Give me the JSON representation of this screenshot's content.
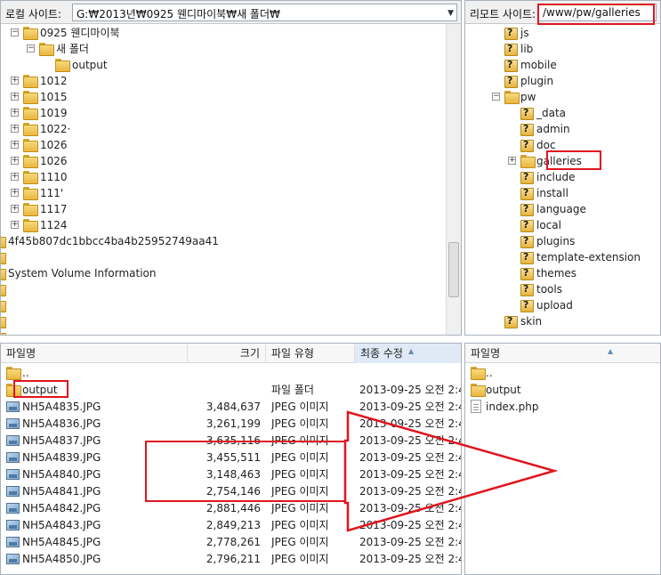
{
  "local_site": {
    "label": "로컬 사이트:",
    "path": "G:₩2013년₩0925 웬디마이북₩새 폴더₩",
    "tree": [
      {
        "label": "0925 웬디마이북",
        "level": 4,
        "state": "expanded",
        "type": "folder"
      },
      {
        "label": "새 폴더",
        "level": 5,
        "state": "expanded",
        "type": "folder"
      },
      {
        "label": "output",
        "level": 6,
        "state": "leaf",
        "type": "folder"
      },
      {
        "label": "1012",
        "level": 4,
        "state": "collapsed",
        "type": "folder"
      },
      {
        "label": "1015",
        "level": 4,
        "state": "collapsed",
        "type": "folder"
      },
      {
        "label": "1019",
        "level": 4,
        "state": "collapsed",
        "type": "folder"
      },
      {
        "label": "1022·",
        "level": 4,
        "state": "collapsed",
        "type": "folder"
      },
      {
        "label": "1026",
        "level": 4,
        "state": "collapsed",
        "type": "folder"
      },
      {
        "label": "1026",
        "level": 4,
        "state": "collapsed",
        "type": "folder"
      },
      {
        "label": "1110",
        "level": 4,
        "state": "collapsed",
        "type": "folder"
      },
      {
        "label": "111'",
        "level": 4,
        "state": "collapsed",
        "type": "folder"
      },
      {
        "label": "1117",
        "level": 4,
        "state": "collapsed",
        "type": "folder"
      },
      {
        "label": "1124",
        "level": 4,
        "state": "collapsed",
        "type": "folder"
      },
      {
        "label": "4f45b807dc1bbcc4ba4b25952749aa41",
        "level": 2,
        "state": "collapsed",
        "type": "folder"
      },
      {
        "label": "",
        "level": 2,
        "state": "leaf",
        "type": "folder"
      },
      {
        "label": "System Volume Information",
        "level": 2,
        "state": "leaf",
        "type": "folder"
      },
      {
        "label": "",
        "level": 2,
        "state": "collapsed",
        "type": "folder"
      },
      {
        "label": "",
        "level": 2,
        "state": "collapsed",
        "type": "folder"
      },
      {
        "label": "",
        "level": 2,
        "state": "collapsed",
        "type": "folder"
      },
      {
        "label": "",
        "level": 2,
        "state": "collapsed",
        "type": "folder"
      }
    ],
    "list_headers": [
      "파일명",
      "크기",
      "파일 유형",
      "최종 수정"
    ],
    "list": [
      {
        "name": "..",
        "size": "",
        "type": "",
        "modified": "",
        "icon": "folder"
      },
      {
        "name": "output",
        "size": "",
        "type": "파일 폴더",
        "modified": "2013-09-25 오전 2:4",
        "icon": "folder"
      },
      {
        "name": "NH5A4835.JPG",
        "size": "3,484,637",
        "type": "JPEG 이미지",
        "modified": "2013-09-25 오전 2:4",
        "icon": "image"
      },
      {
        "name": "NH5A4836.JPG",
        "size": "3,261,199",
        "type": "JPEG 이미지",
        "modified": "2013-09-25 오전 2:4",
        "icon": "image"
      },
      {
        "name": "NH5A4837.JPG",
        "size": "3,635,116",
        "type": "JPEG 이미지",
        "modified": "2013-09-25 오전 2:4",
        "icon": "image"
      },
      {
        "name": "NH5A4839.JPG",
        "size": "3,455,511",
        "type": "JPEG 이미지",
        "modified": "2013-09-25 오전 2:4",
        "icon": "image"
      },
      {
        "name": "NH5A4840.JPG",
        "size": "3,148,463",
        "type": "JPEG 이미지",
        "modified": "2013-09-25 오전 2:4",
        "icon": "image"
      },
      {
        "name": "NH5A4841.JPG",
        "size": "2,754,146",
        "type": "JPEG 이미지",
        "modified": "2013-09-25 오전 2:4",
        "icon": "image"
      },
      {
        "name": "NH5A4842.JPG",
        "size": "2,881,446",
        "type": "JPEG 이미지",
        "modified": "2013-09-25 오전 2:4",
        "icon": "image"
      },
      {
        "name": "NH5A4843.JPG",
        "size": "2,849,213",
        "type": "JPEG 이미지",
        "modified": "2013-09-25 오전 2:4",
        "icon": "image"
      },
      {
        "name": "NH5A4845.JPG",
        "size": "2,778,261",
        "type": "JPEG 이미지",
        "modified": "2013-09-25 오전 2:4",
        "icon": "image"
      },
      {
        "name": "NH5A4850.JPG",
        "size": "2,796,211",
        "type": "JPEG 이미지",
        "modified": "2013-09-25 오전 2:4",
        "icon": "image"
      }
    ]
  },
  "remote_site": {
    "label": "리모트 사이트:",
    "path": "/www/pw/galleries",
    "tree": [
      {
        "label": "js",
        "level": 1,
        "state": "leaf",
        "type": "unknown"
      },
      {
        "label": "lib",
        "level": 1,
        "state": "leaf",
        "type": "unknown"
      },
      {
        "label": "mobile",
        "level": 1,
        "state": "leaf",
        "type": "unknown"
      },
      {
        "label": "plugin",
        "level": 1,
        "state": "leaf",
        "type": "unknown"
      },
      {
        "label": "pw",
        "level": 1,
        "state": "expanded",
        "type": "folder"
      },
      {
        "label": "_data",
        "level": 2,
        "state": "leaf",
        "type": "unknown"
      },
      {
        "label": "admin",
        "level": 2,
        "state": "leaf",
        "type": "unknown"
      },
      {
        "label": "doc",
        "level": 2,
        "state": "leaf",
        "type": "unknown"
      },
      {
        "label": "galleries",
        "level": 2,
        "state": "collapsed",
        "type": "folder"
      },
      {
        "label": "include",
        "level": 2,
        "state": "leaf",
        "type": "unknown"
      },
      {
        "label": "install",
        "level": 2,
        "state": "leaf",
        "type": "unknown"
      },
      {
        "label": "language",
        "level": 2,
        "state": "leaf",
        "type": "unknown"
      },
      {
        "label": "local",
        "level": 2,
        "state": "leaf",
        "type": "unknown"
      },
      {
        "label": "plugins",
        "level": 2,
        "state": "leaf",
        "type": "unknown"
      },
      {
        "label": "template-extension",
        "level": 2,
        "state": "leaf",
        "type": "unknown"
      },
      {
        "label": "themes",
        "level": 2,
        "state": "leaf",
        "type": "unknown"
      },
      {
        "label": "tools",
        "level": 2,
        "state": "leaf",
        "type": "unknown"
      },
      {
        "label": "upload",
        "level": 2,
        "state": "leaf",
        "type": "unknown"
      },
      {
        "label": "skin",
        "level": 1,
        "state": "leaf",
        "type": "unknown"
      }
    ],
    "list_headers": [
      "파일명"
    ],
    "list": [
      {
        "name": "..",
        "icon": "folder"
      },
      {
        "name": "output",
        "icon": "folder"
      },
      {
        "name": "index.php",
        "icon": "file"
      }
    ]
  },
  "colors": {
    "highlight": "#e0151f",
    "border": "#a9b2bd",
    "header_bg": "#f7f7f7",
    "sorted_header_bg": "#dfeaf6"
  }
}
